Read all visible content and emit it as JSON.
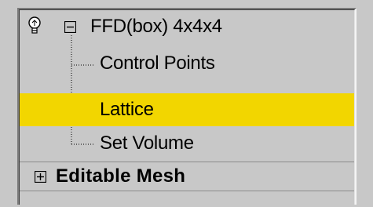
{
  "modifier_stack": {
    "ffd": {
      "label": "FFD(box) 4x4x4",
      "icons": [
        "lightbulb-icon",
        "minus-box-icon"
      ]
    },
    "subobjects": [
      {
        "label": "Control Points",
        "selected": false
      },
      {
        "label": "Lattice",
        "selected": true
      },
      {
        "label": "Set Volume",
        "selected": false
      }
    ],
    "editable_mesh": {
      "label": "Editable Mesh",
      "icon": "plus-box-icon"
    }
  },
  "colors": {
    "selection": "#f2d600",
    "panel": "#c8c8c8"
  }
}
